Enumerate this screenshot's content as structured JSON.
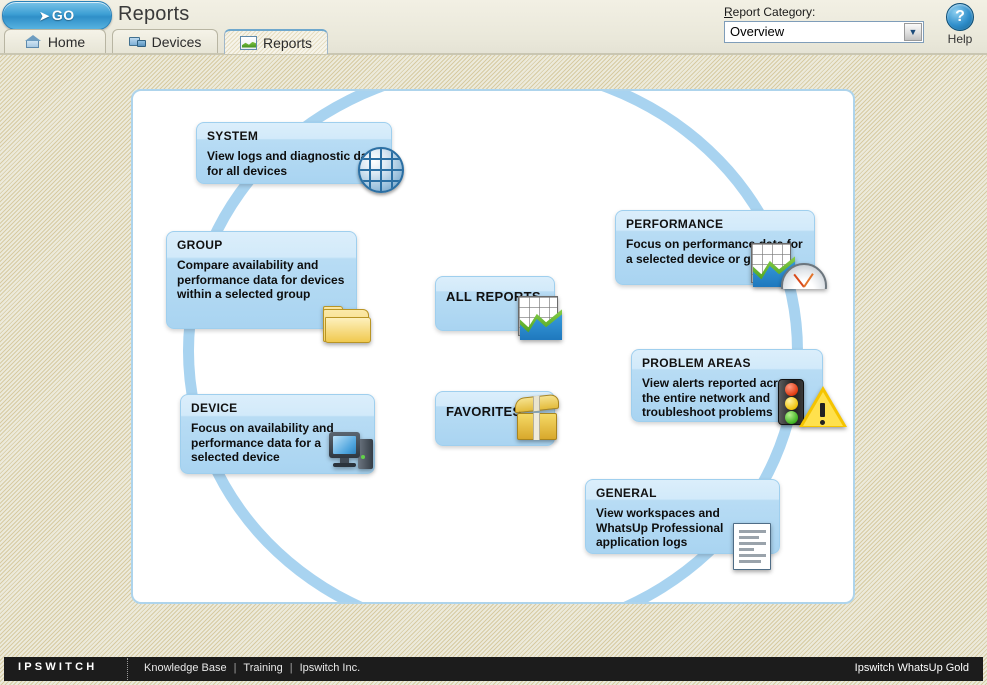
{
  "header": {
    "go_button": {
      "arrow": "➤",
      "label": "GO"
    },
    "page_title": "Reports",
    "category": {
      "label_prefix": "R",
      "label_rest": "eport Category:",
      "selected": "Overview",
      "arrow": "▼",
      "options": [
        "Overview"
      ]
    },
    "help": {
      "glyph": "?",
      "label": "Help"
    }
  },
  "tabs": [
    {
      "id": "home",
      "label": "Home",
      "icon": "house-icon",
      "active": false
    },
    {
      "id": "devices",
      "label": "Devices",
      "icon": "devices-icon",
      "active": false
    },
    {
      "id": "reports",
      "label": "Reports",
      "icon": "chart-icon",
      "active": true
    }
  ],
  "cards": {
    "system": {
      "title": "SYSTEM",
      "body": "View logs and diagnostic data for all devices",
      "icon": "globe-icon"
    },
    "group": {
      "title": "GROUP",
      "body": "Compare availability and performance data for devices within a selected group",
      "icon": "folder-icon"
    },
    "device": {
      "title": "DEVICE",
      "body": "Focus on availability and performance data for a selected device",
      "icon": "desktop-computer-icon"
    },
    "all_reports": {
      "title": "ALL REPORTS",
      "body": "",
      "icon": "chart-grid-icon"
    },
    "favorites": {
      "title": "FAVORITES",
      "body": "",
      "icon": "treasure-chest-icon"
    },
    "performance": {
      "title": "PERFORMANCE",
      "body": "Focus on performance data for a selected device or group",
      "icon": "chart-gauge-icon"
    },
    "problem_areas": {
      "title": "PROBLEM AREAS",
      "body": "View alerts reported across the entire network and troubleshoot problems",
      "icon": "traffic-light-warning-icon"
    },
    "general": {
      "title": "GENERAL",
      "body": "View workspaces and WhatsUp Professional application logs",
      "icon": "document-icon"
    }
  },
  "footer": {
    "logo": "IPSWITCH",
    "links": [
      "Knowledge Base",
      "Training",
      "Ipswitch Inc."
    ],
    "separator": "|",
    "product": "Ipswitch WhatsUp Gold"
  },
  "colors": {
    "accent_blue": "#a8d3f0",
    "card_blue": "#a9d4f1",
    "card_header_blue": "#d2eafa",
    "background_beige": "#eceadb",
    "footer_black": "#1c1c1c",
    "go_blue": "#3d9fd4"
  }
}
